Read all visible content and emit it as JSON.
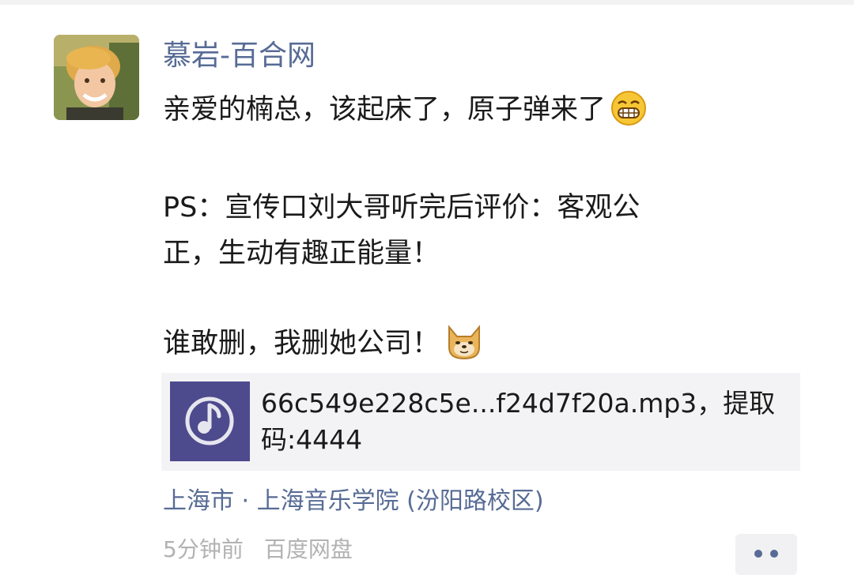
{
  "post": {
    "author": "慕岩-百合网",
    "lines": {
      "line1": "亲爱的楠总，该起床了，原子弹来了",
      "line2": "PS：宣传口刘大哥听完后评价：客观公",
      "line3": "正，生动有趣正能量！",
      "line4": "谁敢删，我删她公司！"
    },
    "emojis": {
      "first": "grin-emoji",
      "second": "doge-emoji"
    },
    "share_card": {
      "title": "66c549e228c5e...f24d7f20a.mp3，提取码:4444",
      "thumb_icon": "music-note-icon",
      "thumb_color": "#4e4a8e"
    },
    "location": "上海市 · 上海音乐学院 (汾阳路校区)",
    "time": "5分钟前",
    "source": "百度网盘"
  },
  "colors": {
    "link_blue": "#576b95",
    "meta_gray": "#b2b2b2",
    "card_bg": "#f3f3f5"
  }
}
